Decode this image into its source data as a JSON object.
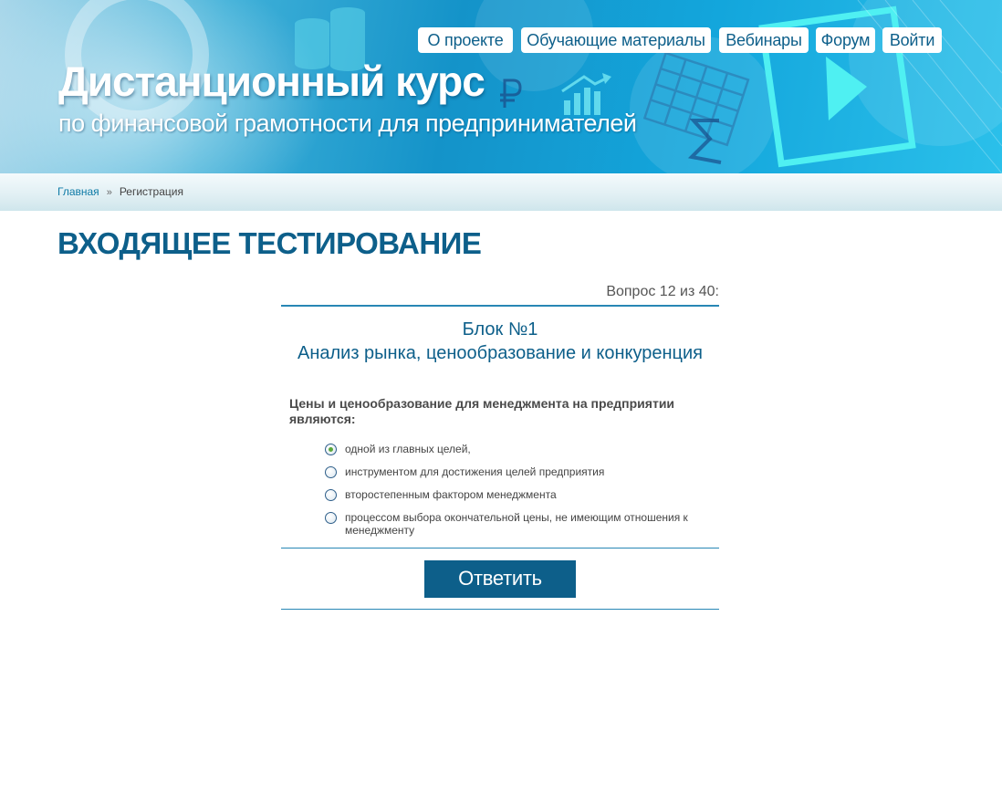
{
  "header": {
    "title": "Дистанционный курс",
    "subtitle": "по финансовой грамотности для предпринимателей",
    "nav": [
      {
        "label": "О проекте"
      },
      {
        "label": "Обучающие материалы"
      },
      {
        "label": "Вебинары"
      },
      {
        "label": "Форум"
      },
      {
        "label": "Войти"
      }
    ]
  },
  "breadcrumb": {
    "home": "Главная",
    "separator": "»",
    "current": "Регистрация"
  },
  "page": {
    "title": "ВХОДЯЩЕЕ ТЕСТИРОВАНИЕ"
  },
  "test": {
    "counter": "Вопрос 12 из 40:",
    "block_number": "Блок №1",
    "block_name": "Анализ рынка, ценообразование и конкуренция",
    "question": "Цены и ценообразование для менеджмента на предприятии являются:",
    "answers": [
      {
        "label": "одной из главных целей,",
        "selected": true
      },
      {
        "label": "инструментом для достижения целей предприятия",
        "selected": false
      },
      {
        "label": "второстепенным фактором менеджмента",
        "selected": false
      },
      {
        "label": "процессом выбора окончательной цены, не имеющим отношения к менеджменту",
        "selected": false
      }
    ],
    "submit_label": "Ответить"
  },
  "colors": {
    "accent": "#0d5f8a",
    "link": "#0d7aa6",
    "rule": "#2887b5",
    "radio_selected": "#5aa83c"
  },
  "icons": [
    "coins-stack-icon",
    "ruble-icon",
    "growth-chart-icon",
    "spreadsheet-icon",
    "sigma-icon",
    "play-video-icon"
  ]
}
